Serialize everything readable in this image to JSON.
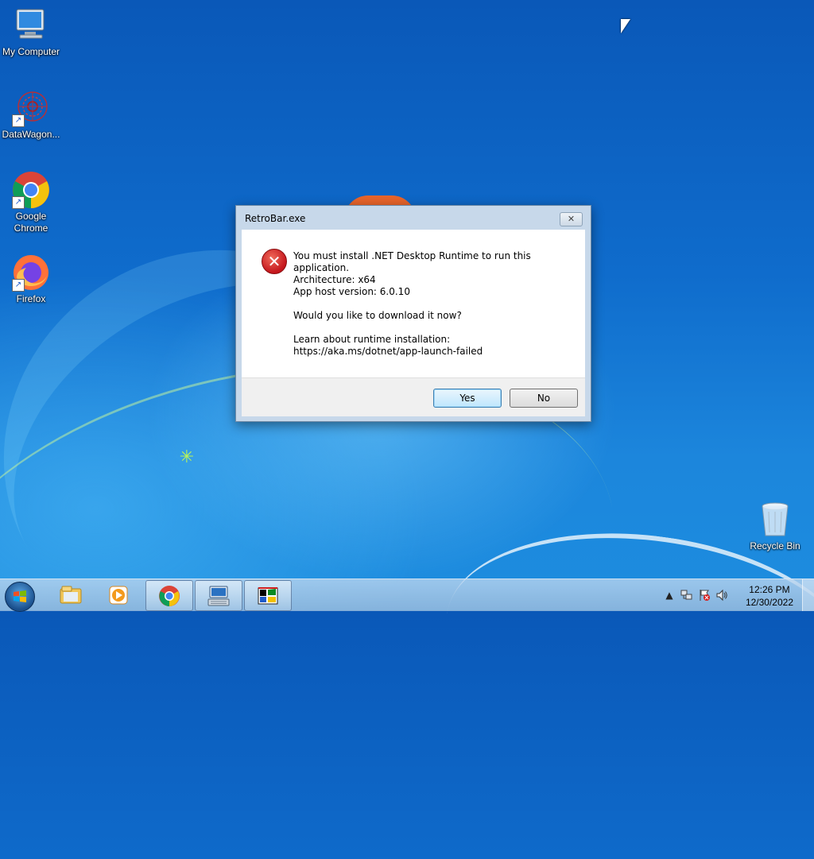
{
  "desktop": {
    "icons": [
      {
        "label": "My Computer",
        "icon": "computer-icon"
      },
      {
        "label": "DataWagon...",
        "icon": "datawagon-icon"
      },
      {
        "label": "Google Chrome",
        "icon": "chrome-icon"
      },
      {
        "label": "Firefox",
        "icon": "firefox-icon"
      },
      {
        "label": "Recycle Bin",
        "icon": "recycle-bin-icon"
      }
    ]
  },
  "dialog": {
    "title": "RetroBar.exe",
    "close_glyph": "✕",
    "lines": [
      "You must install .NET Desktop Runtime to run this application.",
      "Architecture: x64",
      "App host version: 6.0.10",
      "Would you like to download it now?",
      "Learn about runtime installation:",
      "https://aka.ms/dotnet/app-launch-failed"
    ],
    "yes_label": "Yes",
    "no_label": "No",
    "icon": "error-icon"
  },
  "taskbar": {
    "buttons": [
      {
        "icon": "file-explorer-icon",
        "active": false
      },
      {
        "icon": "media-player-icon",
        "active": false
      },
      {
        "icon": "chrome-icon",
        "active": true
      },
      {
        "icon": "keyboard-app-icon",
        "active": true
      },
      {
        "icon": "retrobar-icon",
        "active": true
      }
    ],
    "tray": {
      "time": "12:26 PM",
      "date": "12/30/2022"
    }
  },
  "colors": {
    "desktop_blue": "#0f6ccc",
    "error_red": "#c4161c",
    "yes_button_border": "#3c7fb1"
  }
}
